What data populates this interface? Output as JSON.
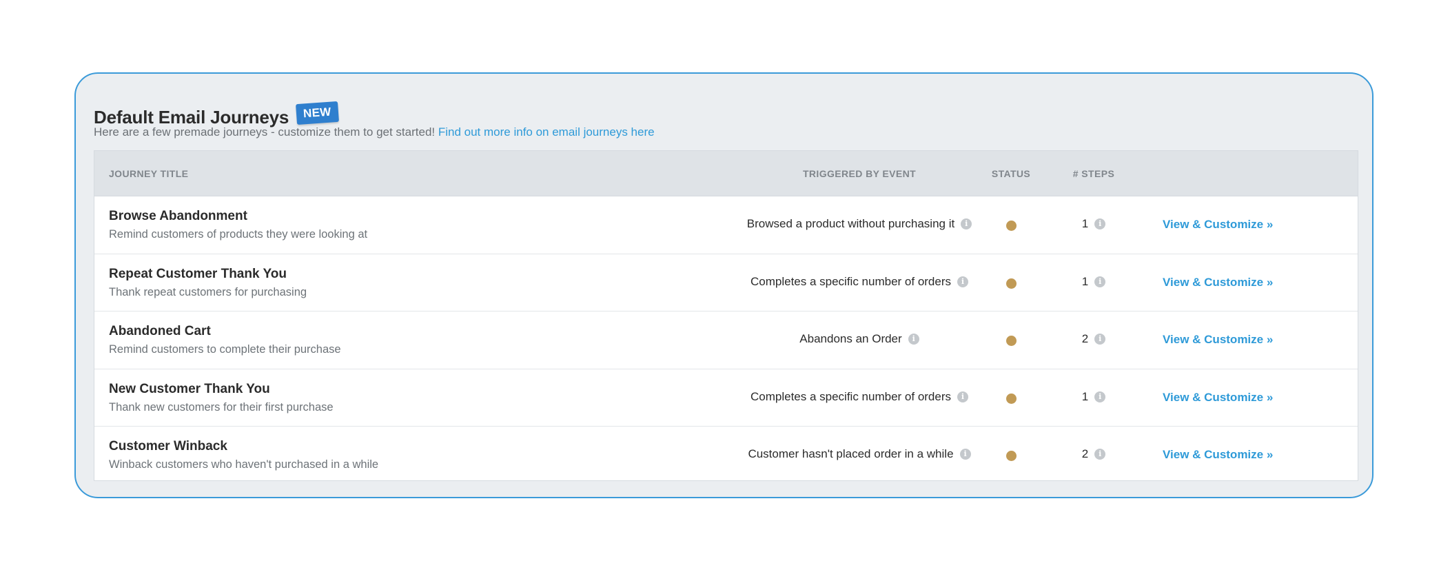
{
  "header": {
    "title": "Default Email Journeys",
    "badge": "NEW",
    "subtitle": "Here are a few premade journeys - customize them to get started!",
    "subtitle_link": "Find out more info on email journeys here"
  },
  "table": {
    "columns": {
      "title": "Journey Title",
      "event": "Triggered By Event",
      "status": "Status",
      "steps": "# Steps"
    },
    "rows": [
      {
        "title": "Browse Abandonment",
        "description": "Remind customers of products they were looking at",
        "event": "Browsed a product without purchasing it",
        "steps": "1",
        "action": "View & Customize »"
      },
      {
        "title": "Repeat Customer Thank You",
        "description": "Thank repeat customers for purchasing",
        "event": "Completes a specific number of orders",
        "steps": "1",
        "action": "View & Customize »"
      },
      {
        "title": "Abandoned Cart",
        "description": "Remind customers to complete their purchase",
        "event": "Abandons an Order",
        "steps": "2",
        "action": "View & Customize »"
      },
      {
        "title": "New Customer Thank You",
        "description": "Thank new customers for their first purchase",
        "event": "Completes a specific number of orders",
        "steps": "1",
        "action": "View & Customize »"
      },
      {
        "title": "Customer Winback",
        "description": "Winback customers who haven't purchased in a while",
        "event": "Customer hasn't placed order in a while",
        "steps": "2",
        "action": "View & Customize »"
      }
    ]
  },
  "icons": {
    "info": "info-icon",
    "status": "status-dot-icon"
  },
  "colors": {
    "accent": "#2e9ad8",
    "border": "#3a9ad9",
    "badge": "#2f7fce",
    "status_dot": "#c19a55"
  }
}
